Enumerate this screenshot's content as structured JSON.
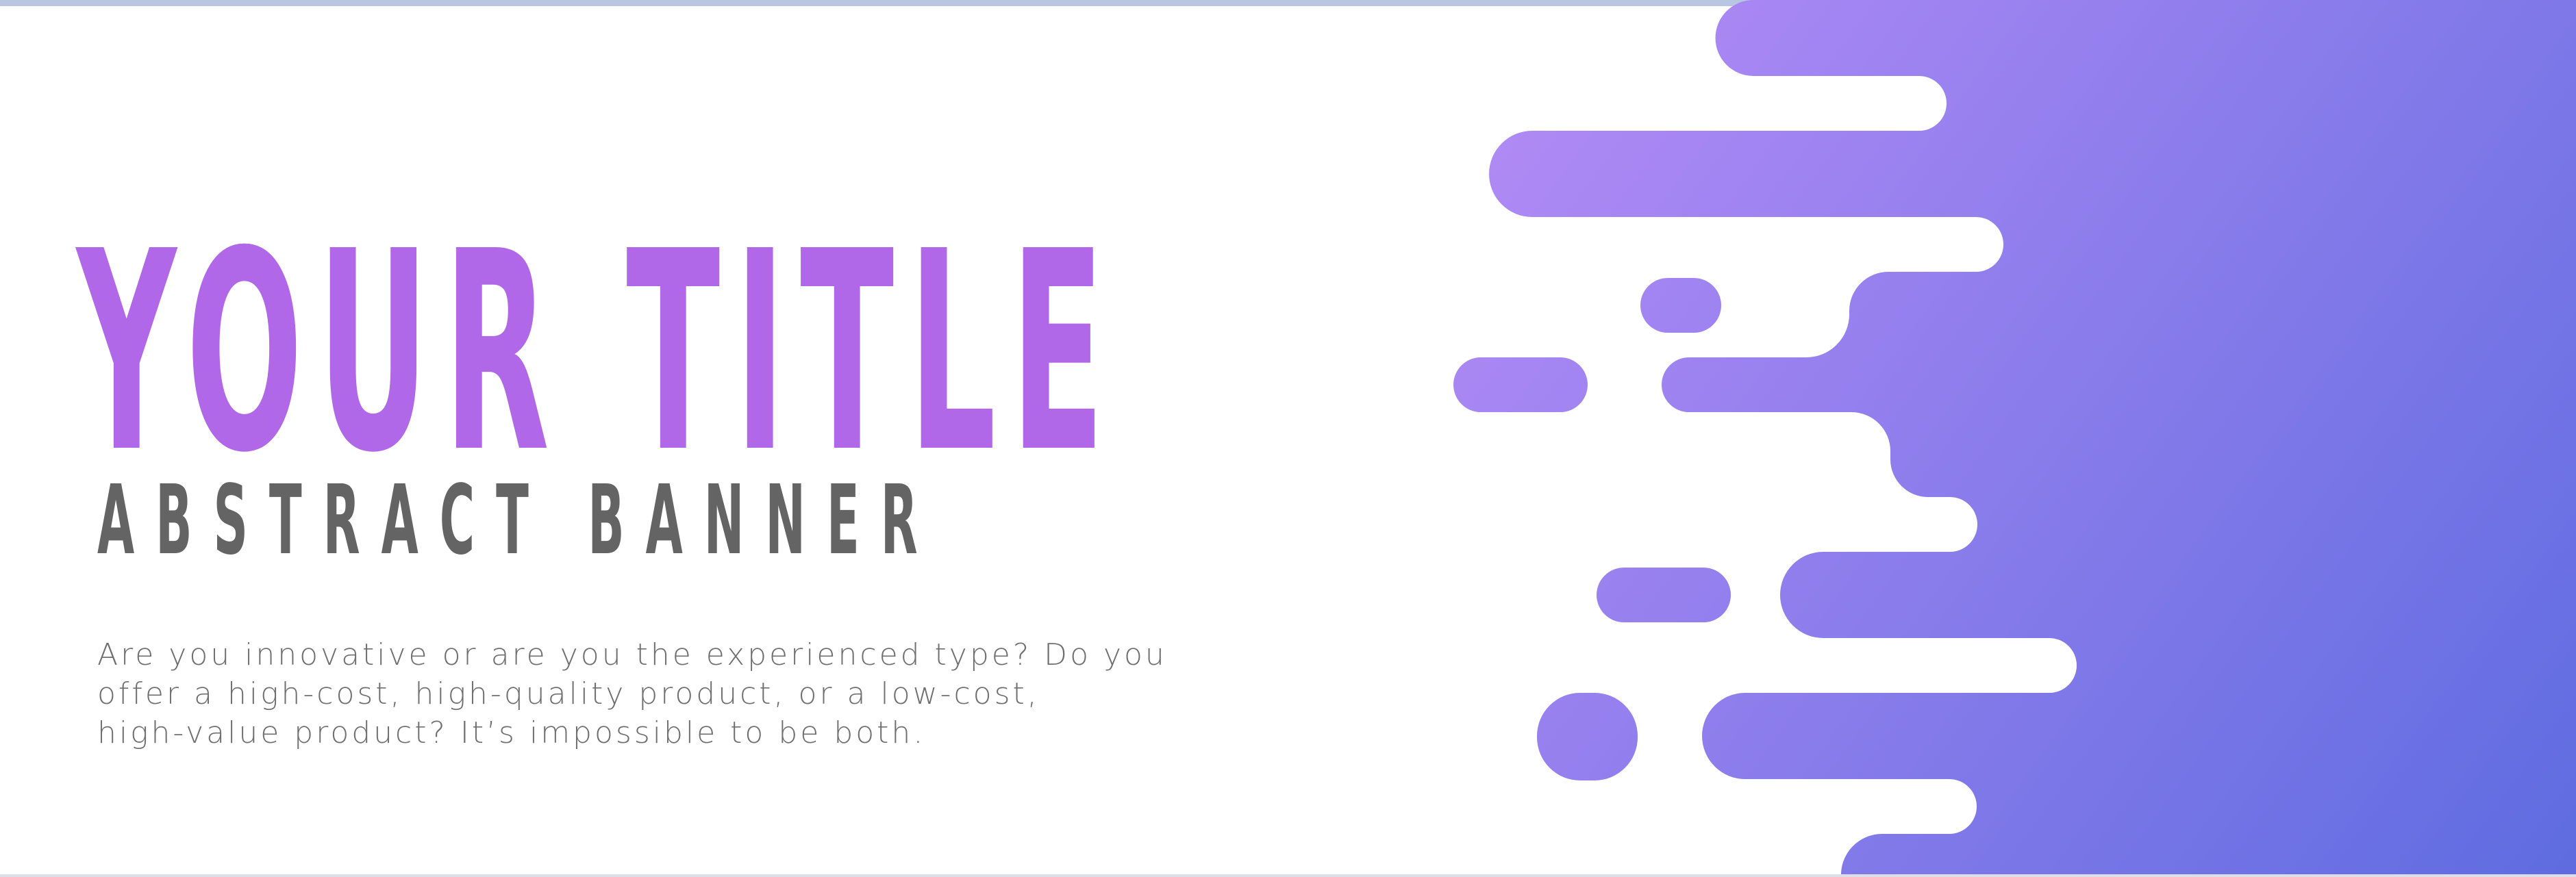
{
  "banner": {
    "title": "YOUR TITLE",
    "subtitle": "ABSTRACT BANNER",
    "body_lines": [
      "Are you innovative or are you the experienced type? Do you",
      "offer a high-cost, high-quality product, or a low-cost,",
      "high-value product? It’s impossible to be both."
    ],
    "colors": {
      "title": "#b168e8",
      "subtitle": "#646464",
      "body": "#6f6f6f",
      "gradient_start": "#b08af5",
      "gradient_end": "#5e6ce0",
      "top_strip": "#b9c6e2"
    }
  }
}
